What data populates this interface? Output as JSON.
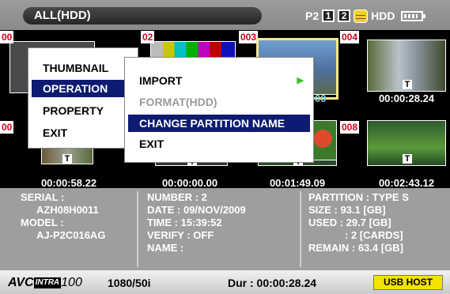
{
  "header": {
    "title": "ALL(HDD)",
    "p2_label": "P2",
    "slot1": "1",
    "slot2": "2",
    "hdd_label": "HDD"
  },
  "clips": [
    {
      "num": "00",
      "tc": "00:00:58.22"
    },
    {
      "num": "02",
      "tc": "00:00:00.00"
    },
    {
      "num": "003",
      "tc": "00:01:49.09"
    },
    {
      "num": "004",
      "tc": "00:00:28.24"
    },
    {
      "num": "00",
      "tc": ""
    },
    {
      "num": "008",
      "tc": "00:02:43.12"
    }
  ],
  "t_mark": "T",
  "partial_tc_003": "00",
  "menu": {
    "main": [
      {
        "label": "THUMBNAIL"
      },
      {
        "label": "OPERATION"
      },
      {
        "label": "PROPERTY"
      },
      {
        "label": "EXIT"
      }
    ],
    "sub": [
      {
        "label": "IMPORT"
      },
      {
        "label": "FORMAT(HDD)"
      },
      {
        "label": "CHANGE PARTITION NAME"
      },
      {
        "label": "EXIT"
      }
    ]
  },
  "info": {
    "col1": [
      "SERIAL :",
      "AZH08H0011",
      "MODEL :",
      "AJ-P2C016AG"
    ],
    "col2": [
      "NUMBER : 2",
      "DATE : 09/NOV/2009",
      "TIME : 15:39:52",
      "VERIFY : OFF",
      "NAME :"
    ],
    "col3": [
      "PARTITION : TYPE S",
      "SIZE : 93.1 [GB]",
      "USED : 29.7 [GB]",
      ": 2 [CARDS]",
      "REMAIN : 63.4 [GB]"
    ]
  },
  "footer": {
    "avc": "AVC",
    "intra": "INTRA",
    "rate": "100",
    "format": "1080/50i",
    "duration": "Dur : 00:00:28.24",
    "usb": "USB HOST"
  },
  "colors": {
    "highlight": "#0d1b73",
    "selection": "#f3e98a",
    "usb": "#f3e300",
    "clip_num": "#d4001a"
  }
}
